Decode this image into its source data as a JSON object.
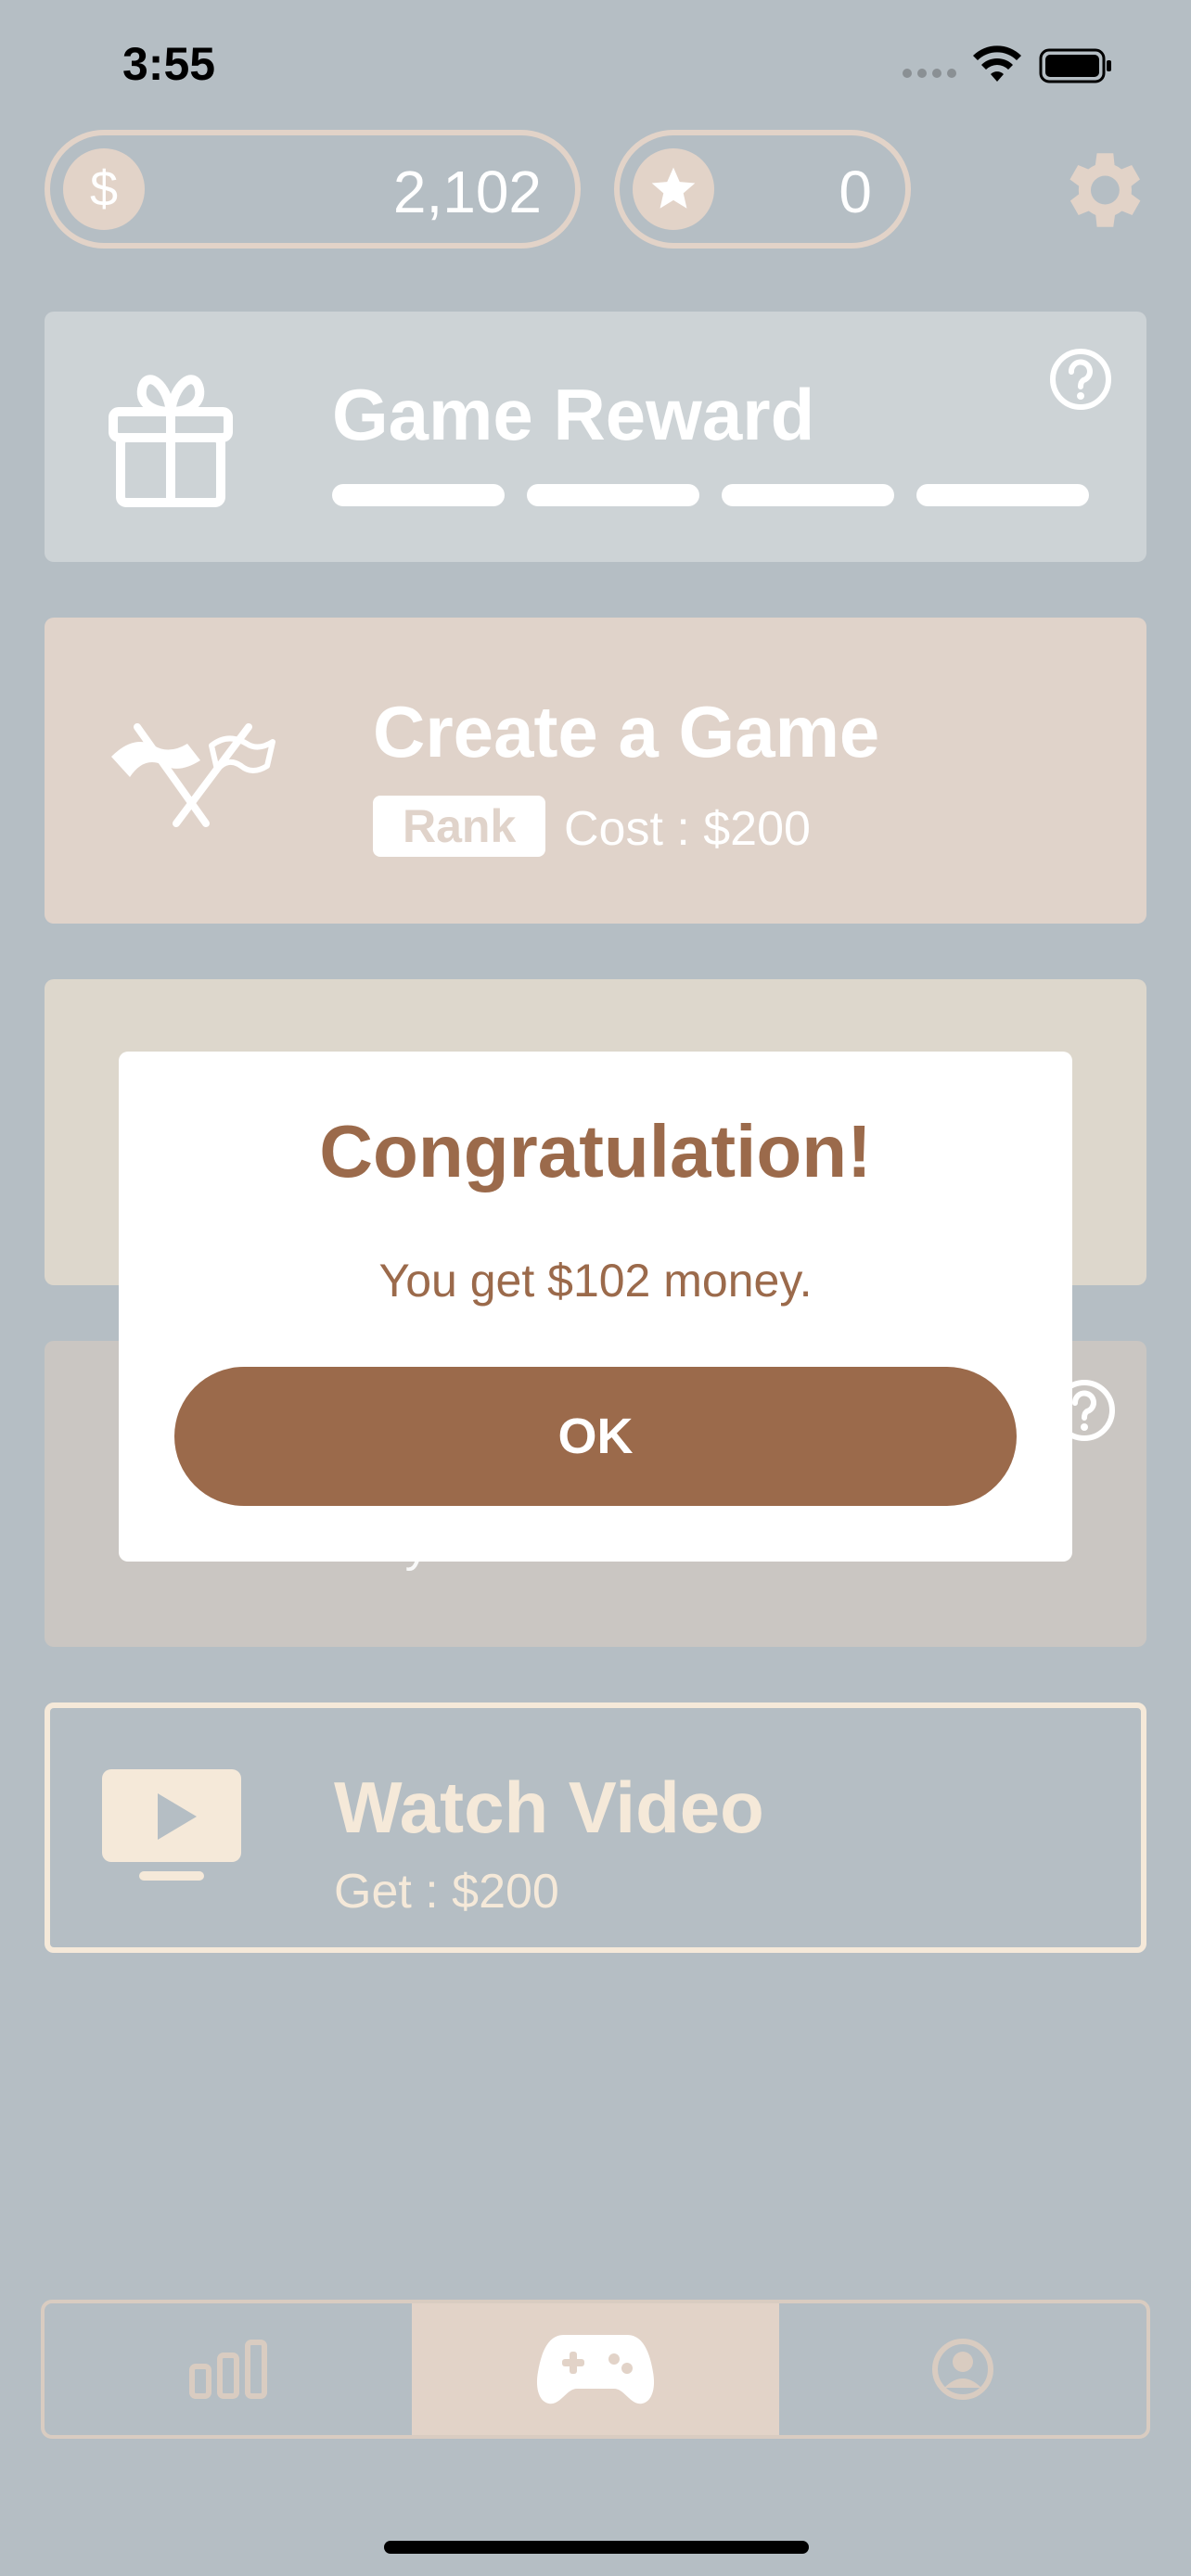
{
  "status_bar": {
    "time": "3:55"
  },
  "header": {
    "money": {
      "symbol": "$",
      "value": "2,102"
    },
    "stars": {
      "value": "0"
    }
  },
  "cards": {
    "reward": {
      "title": "Game Reward",
      "progress_segments": 4
    },
    "create": {
      "title": "Create a Game",
      "badge": "Rank",
      "cost": "Cost : $200"
    },
    "fourth": {
      "subtitle": "By Room ID"
    },
    "video": {
      "title": "Watch Video",
      "reward": "Get : $200"
    }
  },
  "modal": {
    "title": "Congratulation!",
    "message": "You get $102 money.",
    "ok_label": "OK"
  },
  "tabbar": {
    "tabs": [
      {
        "icon": "chart-bars-icon",
        "active": false
      },
      {
        "icon": "gamepad-icon",
        "active": true
      },
      {
        "icon": "profile-icon",
        "active": false
      }
    ]
  },
  "colors": {
    "background": "#b5bec4",
    "accent_brown": "#9b6a4b",
    "beige": "#e2d3c8",
    "cream": "#f5e9d9"
  }
}
